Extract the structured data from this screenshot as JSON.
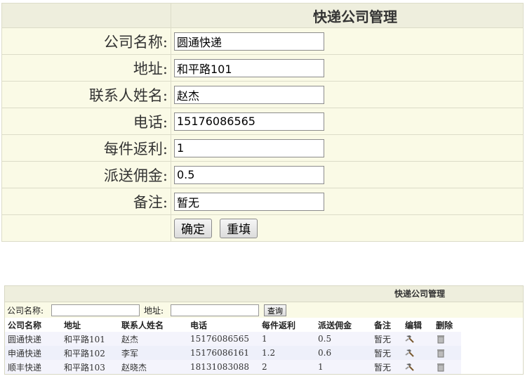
{
  "form": {
    "title": "快递公司管理",
    "fields": [
      {
        "label": "公司名称:",
        "value": "圆通快递"
      },
      {
        "label": "地址:",
        "value": "和平路101"
      },
      {
        "label": "联系人姓名:",
        "value": "赵杰"
      },
      {
        "label": "电话:",
        "value": "15176086565"
      },
      {
        "label": "每件返利:",
        "value": "1"
      },
      {
        "label": "派送佣金:",
        "value": "0.5"
      },
      {
        "label": "备注:",
        "value": "暂无"
      }
    ],
    "confirm_label": "确定",
    "reset_label": "重填"
  },
  "list": {
    "title": "快递公司管理",
    "search": {
      "name_label": "公司名称:",
      "address_label": "地址:",
      "query_label": "查询"
    },
    "columns": [
      "公司名称",
      "地址",
      "联系人姓名",
      "电话",
      "每件返利",
      "派送佣金",
      "备注",
      "编辑",
      "删除"
    ],
    "rows": [
      [
        "圆通快递",
        "和平路101",
        "赵杰",
        "15176086565",
        "1",
        "0.5",
        "暂无"
      ],
      [
        "申通快递",
        "和平路102",
        "李军",
        "15176086161",
        "1.2",
        "0.6",
        "暂无"
      ],
      [
        "顺丰快递",
        "和平路103",
        "赵晓杰",
        "18131083088",
        "2",
        "1",
        "暂无"
      ]
    ],
    "edit_icon": "edit-hammer-icon",
    "delete_icon": "trash-icon"
  }
}
